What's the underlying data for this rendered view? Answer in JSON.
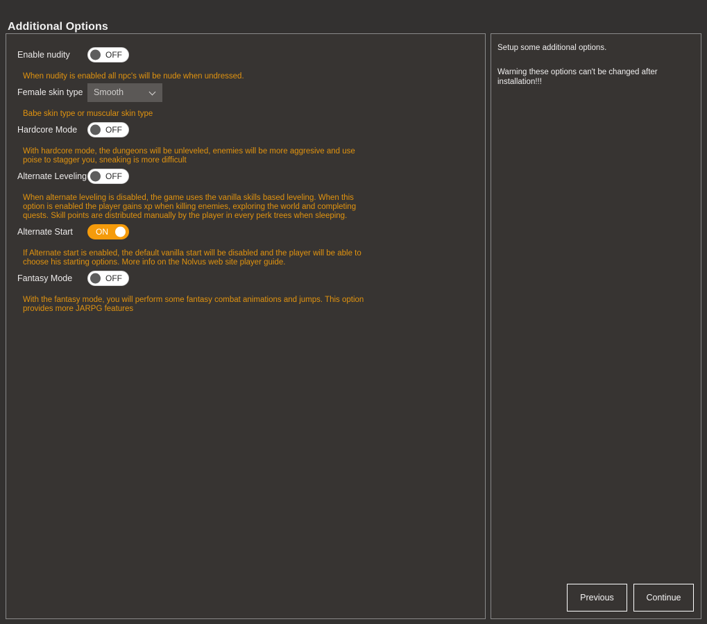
{
  "header": {
    "title": "Additional Options"
  },
  "left_panel": {
    "options": [
      {
        "id": "enable-nudity",
        "label": "Enable nudity",
        "control": "toggle",
        "state": "OFF",
        "description": "When nudity is enabled all npc's will be nude when undressed."
      },
      {
        "id": "female-skin-type",
        "label": "Female skin type",
        "control": "dropdown",
        "value": "Smooth",
        "description": "Babe skin type or muscular skin type"
      },
      {
        "id": "hardcore-mode",
        "label": "Hardcore Mode",
        "control": "toggle",
        "state": "OFF",
        "description": "With hardcore mode, the dungeons will be unleveled, enemies will be more aggresive and use poise to stagger you, sneaking is more difficult"
      },
      {
        "id": "alternate-leveling",
        "label": "Alternate Leveling",
        "control": "toggle",
        "state": "OFF",
        "description": "When alternate leveling is disabled, the game uses the vanilla skills based leveling. When this option is enabled the player gains xp when killing enemies, exploring the world and completing quests. Skill points are distributed manually by the player in every perk trees when sleeping."
      },
      {
        "id": "alternate-start",
        "label": "Alternate Start",
        "control": "toggle",
        "state": "ON",
        "description": "If Alternate start is enabled, the default vanilla start will be disabled and the player will be able to choose his starting options. More info on the Nolvus web site player guide."
      },
      {
        "id": "fantasy-mode",
        "label": "Fantasy Mode",
        "control": "toggle",
        "state": "OFF",
        "description": "With the fantasy mode, you will perform some fantasy combat animations and jumps. This option provides more JARPG features"
      }
    ]
  },
  "right_panel": {
    "info_line_1": "Setup some additional options.",
    "info_line_2": "Warning these options can't be changed after installation!!!"
  },
  "footer": {
    "previous_label": "Previous",
    "continue_label": "Continue"
  },
  "icons": {
    "chevron_down": "chevron-down-icon"
  },
  "colors": {
    "accent_orange": "#e1930f",
    "toggle_on": "#f59b0b",
    "panel_bg": "#373432",
    "window_bg": "#333130",
    "panel_border": "#8a8a8a",
    "text_primary": "#f2f2f2"
  }
}
